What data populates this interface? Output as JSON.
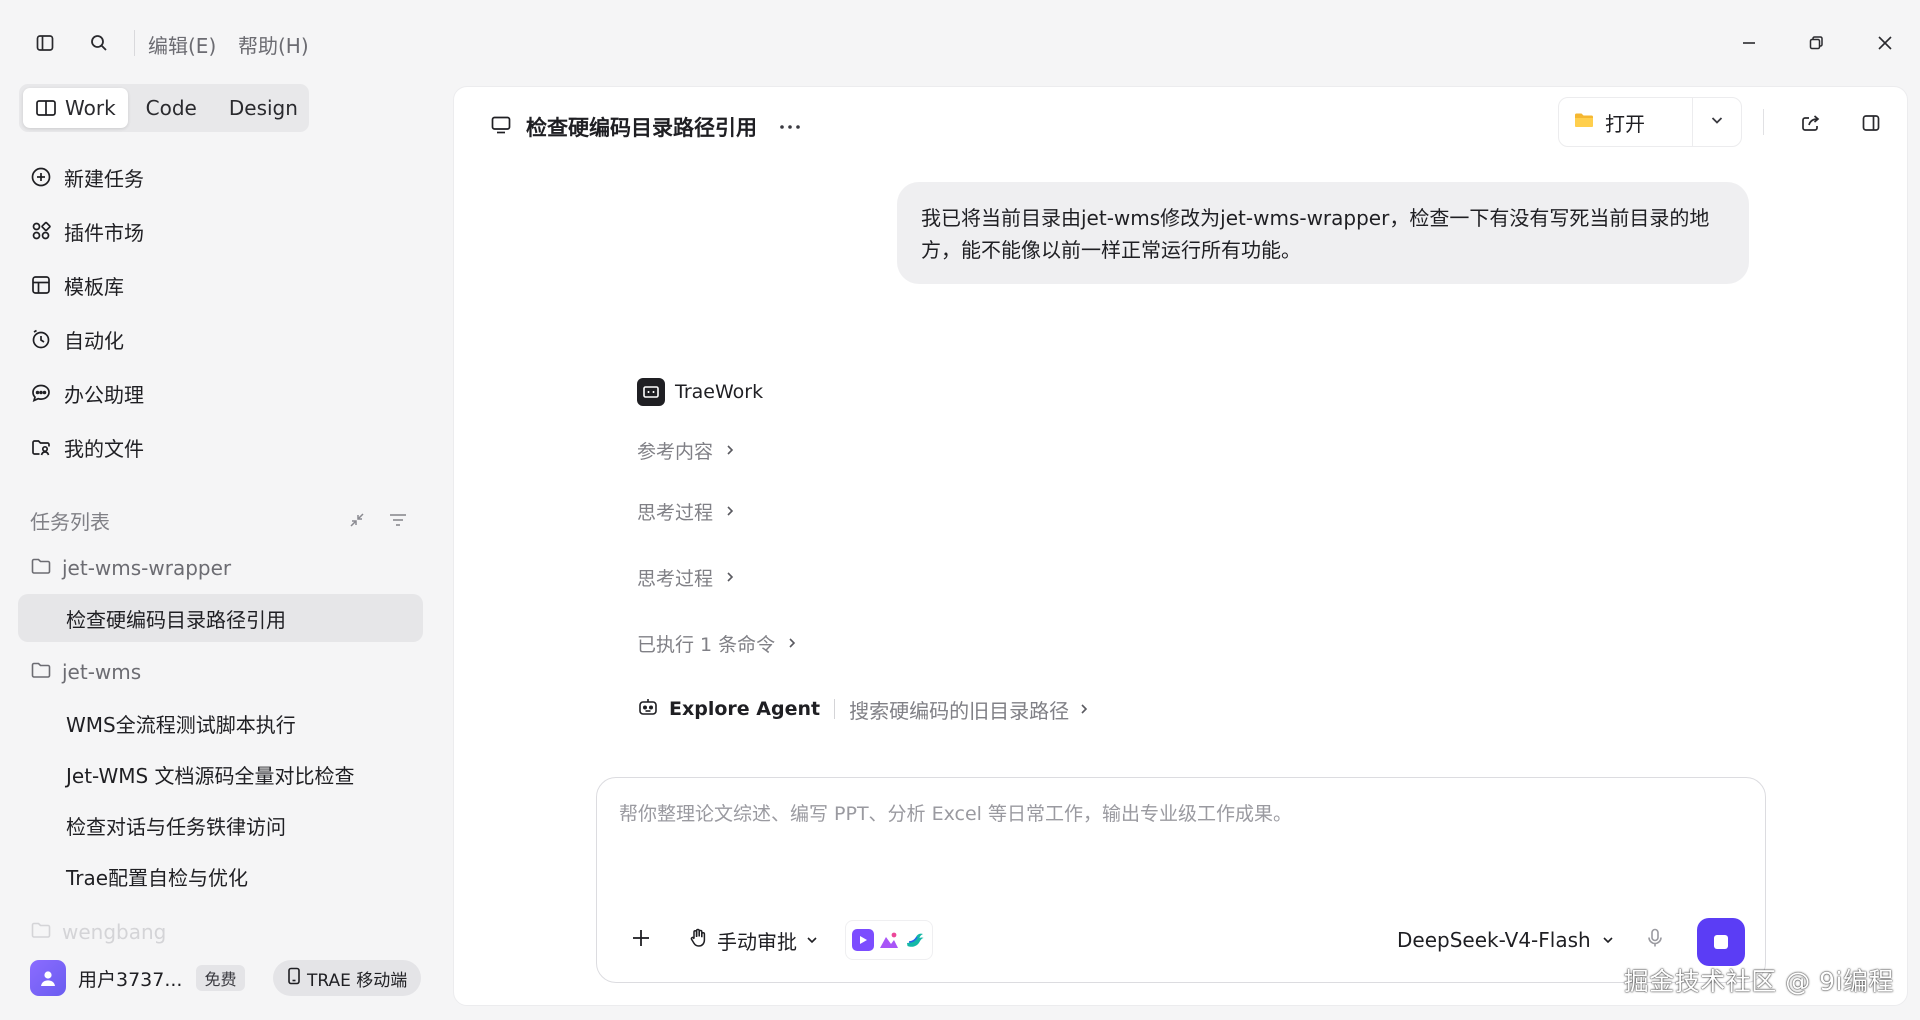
{
  "titlebar": {
    "menu_edit": "编辑(E)",
    "menu_help": "帮助(H)",
    "icons": [
      "sidebar-toggle-icon",
      "search-icon",
      "minimize-icon",
      "restore-icon",
      "close-icon"
    ]
  },
  "sidebar": {
    "modes": [
      {
        "label": "Work",
        "active": true,
        "icon": "book-open-icon"
      },
      {
        "label": "Code",
        "active": false
      },
      {
        "label": "Design",
        "active": false
      }
    ],
    "nav": [
      {
        "label": "新建任务",
        "icon": "plus-circle-icon"
      },
      {
        "label": "插件市场",
        "icon": "apps-icon"
      },
      {
        "label": "模板库",
        "icon": "template-icon"
      },
      {
        "label": "自动化",
        "icon": "clock-icon"
      },
      {
        "label": "办公助理",
        "icon": "chat-icon"
      },
      {
        "label": "我的文件",
        "icon": "folder-user-icon"
      }
    ],
    "task_list_title": "任务列表",
    "folders": [
      {
        "name": "jet-wms-wrapper",
        "tasks": [
          "检查硬编码目录路径引用"
        ]
      },
      {
        "name": "jet-wms",
        "tasks": [
          "WMS全流程测试脚本执行",
          "Jet-WMS 文档源码全量对比检查",
          "检查对话与任务铁律访问",
          "Trae配置自检与优化"
        ]
      }
    ],
    "faded_folder": "wengbang",
    "active_task": "检查硬编码目录路径引用",
    "user": {
      "name": "用户3737...",
      "plan": "免费"
    },
    "mobile_button": "TRAE 移动端"
  },
  "main": {
    "title": "检查硬编码目录路径引用",
    "open_label": "打开",
    "user_message": "我已将当前目录由jet-wms修改为jet-wms-wrapper，检查一下有没有写死当前目录的地方，能不能像以前一样正常运行所有功能。",
    "agent_name": "TraeWork",
    "steps": [
      "参考内容",
      "思考过程",
      "思考过程",
      "已执行 1 条命令"
    ],
    "explore": {
      "name": "Explore Agent",
      "desc": "搜索硬编码的旧目录路径"
    },
    "composer": {
      "placeholder": "帮你整理论文综述、编写 PPT、分析 Excel 等日常工作，输出专业级工作成果。",
      "approval_label": "手动审批",
      "model": "DeepSeek-V4-Flash"
    }
  },
  "watermark": "掘金技术社区 @ 9i编程",
  "colors": {
    "accent": "#5b3df5",
    "sidebar_bg": "#f5f5f6",
    "panel_bg": "#ffffff"
  }
}
